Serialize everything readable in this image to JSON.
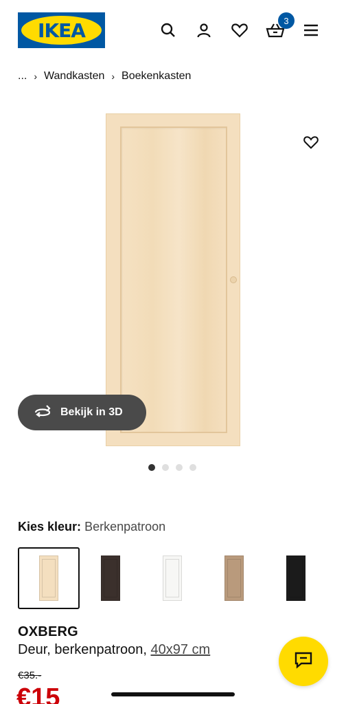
{
  "header": {
    "logo_text": "IKEA",
    "cart_count": "3",
    "icons": [
      "search-icon",
      "account-icon",
      "heart-icon",
      "basket-icon",
      "menu-icon"
    ],
    "colors": {
      "logo_blue": "#0058a3",
      "logo_yellow": "#ffdb00"
    }
  },
  "breadcrumb": {
    "ellipsis": "...",
    "items": [
      "Wandkasten",
      "Boekenkasten"
    ]
  },
  "gallery": {
    "view3d_label": "Bekijk in 3D",
    "image_count": 4,
    "active_index": 0
  },
  "color_picker": {
    "label": "Kies kleur:",
    "selected_value": "Berkenpatroon",
    "swatches": [
      {
        "color": "#f4dfbf",
        "selected": true
      },
      {
        "color": "#3b302c",
        "selected": false
      },
      {
        "color": "#f7f7f5",
        "selected": false
      },
      {
        "color": "#b99a7c",
        "selected": false
      },
      {
        "color": "#1b1b1b",
        "selected": false
      }
    ]
  },
  "product": {
    "name": "OXBERG",
    "description": "Deur, berkenpatroon,",
    "size": "40x97 cm",
    "old_price": "€35.-",
    "new_price": "€15"
  },
  "accent": {
    "sale_red": "#cc0008",
    "chat_yellow": "#ffdb00"
  }
}
